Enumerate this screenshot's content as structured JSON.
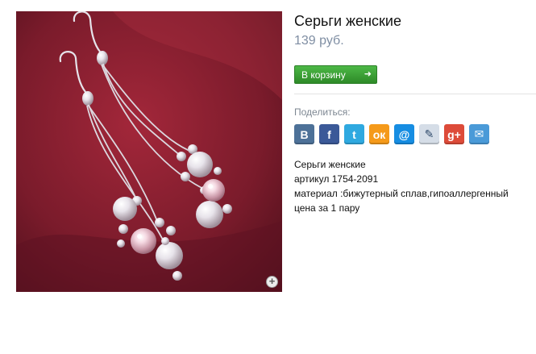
{
  "product": {
    "title": "Серьги женские",
    "price": "139 руб.",
    "cart_button": "В корзину",
    "share_label": "Поделиться:",
    "description": {
      "name": "Серьги женские",
      "article": "артикул 1754-2091",
      "material": "материал :бижутерный сплав,гипоаллергенный",
      "price_note": "цена за 1 пару"
    },
    "zoom_icon": "zoom-plus-icon",
    "image_alt": "Серьги женские"
  },
  "share_icons": [
    {
      "name": "vkontakte",
      "glyph": "В",
      "color": "#4d7198"
    },
    {
      "name": "facebook",
      "glyph": "f",
      "color": "#3b5998"
    },
    {
      "name": "twitter",
      "glyph": "t",
      "color": "#2fa9e0"
    },
    {
      "name": "odnoklassniki",
      "glyph": "ок",
      "color": "#f59a1a"
    },
    {
      "name": "mail-ru",
      "glyph": "@",
      "color": "#168de2"
    },
    {
      "name": "livejournal",
      "glyph": "✎",
      "color": "#d5dde7"
    },
    {
      "name": "google-plus",
      "glyph": "g+",
      "color": "#dd4b39"
    },
    {
      "name": "email",
      "glyph": "✉",
      "color": "#4a9ad8"
    }
  ],
  "colors": {
    "accent_green": "#3aa434",
    "price": "#7f8ea3",
    "image_background": "#7a1e2c"
  }
}
